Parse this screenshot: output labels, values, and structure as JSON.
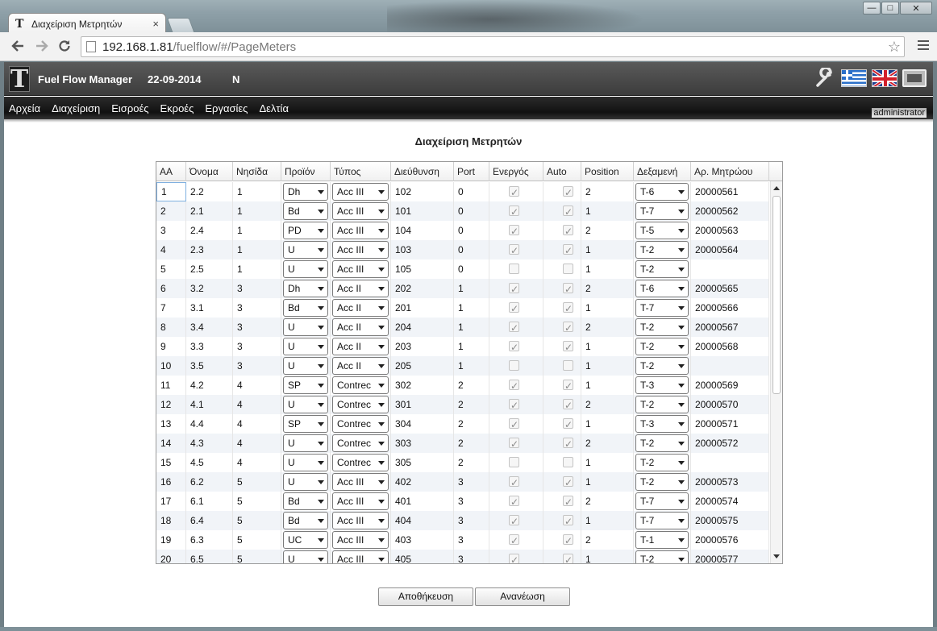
{
  "browser": {
    "tab_title": "Διαχείριση Μετρητών",
    "tab_close": "×",
    "url_host": "192.168.1.81",
    "url_path": "/fuelflow/#/PageMeters",
    "window_min": "—",
    "window_max": "□",
    "window_close": "✕"
  },
  "header": {
    "app_name": "Fuel Flow Manager",
    "date": "22-09-2014",
    "flag": "N",
    "icons": [
      "wrench-icon",
      "greek-flag-icon",
      "uk-flag-icon",
      "screen-icon"
    ]
  },
  "menu": {
    "items": [
      "Αρχεία",
      "Διαχείριση",
      "Εισροές",
      "Εκροές",
      "Εργασίες",
      "Δελτία"
    ],
    "user": "administrator"
  },
  "page": {
    "title": "Διαχείριση Μετρητών"
  },
  "grid": {
    "columns": [
      "ΑΑ",
      "Όνομα",
      "Νησίδα",
      "Προϊόν",
      "Τύπος",
      "Διεύθυνση",
      "Port",
      "Ενεργός",
      "Auto",
      "Position",
      "Δεξαμενή",
      "Αρ. Μητρώου"
    ],
    "rows": [
      {
        "aa": "1",
        "name": "2.2",
        "island": "1",
        "product": "Dh",
        "type": "Acc III",
        "address": "102",
        "port": "0",
        "active": true,
        "auto": true,
        "position": "2",
        "tank": "T-6",
        "serial": "20000561"
      },
      {
        "aa": "2",
        "name": "2.1",
        "island": "1",
        "product": "Bd",
        "type": "Acc III",
        "address": "101",
        "port": "0",
        "active": true,
        "auto": true,
        "position": "1",
        "tank": "T-7",
        "serial": "20000562"
      },
      {
        "aa": "3",
        "name": "2.4",
        "island": "1",
        "product": "PD",
        "type": "Acc III",
        "address": "104",
        "port": "0",
        "active": true,
        "auto": true,
        "position": "2",
        "tank": "T-5",
        "serial": "20000563"
      },
      {
        "aa": "4",
        "name": "2.3",
        "island": "1",
        "product": "U",
        "type": "Acc III",
        "address": "103",
        "port": "0",
        "active": true,
        "auto": true,
        "position": "1",
        "tank": "T-2",
        "serial": "20000564"
      },
      {
        "aa": "5",
        "name": "2.5",
        "island": "1",
        "product": "U",
        "type": "Acc III",
        "address": "105",
        "port": "0",
        "active": false,
        "auto": false,
        "position": "1",
        "tank": "T-2",
        "serial": ""
      },
      {
        "aa": "6",
        "name": "3.2",
        "island": "3",
        "product": "Dh",
        "type": "Acc II",
        "address": "202",
        "port": "1",
        "active": true,
        "auto": true,
        "position": "2",
        "tank": "T-6",
        "serial": "20000565"
      },
      {
        "aa": "7",
        "name": "3.1",
        "island": "3",
        "product": "Bd",
        "type": "Acc II",
        "address": "201",
        "port": "1",
        "active": true,
        "auto": true,
        "position": "1",
        "tank": "T-7",
        "serial": "20000566"
      },
      {
        "aa": "8",
        "name": "3.4",
        "island": "3",
        "product": "U",
        "type": "Acc II",
        "address": "204",
        "port": "1",
        "active": true,
        "auto": true,
        "position": "2",
        "tank": "T-2",
        "serial": "20000567"
      },
      {
        "aa": "9",
        "name": "3.3",
        "island": "3",
        "product": "U",
        "type": "Acc II",
        "address": "203",
        "port": "1",
        "active": true,
        "auto": true,
        "position": "1",
        "tank": "T-2",
        "serial": "20000568"
      },
      {
        "aa": "10",
        "name": "3.5",
        "island": "3",
        "product": "U",
        "type": "Acc II",
        "address": "205",
        "port": "1",
        "active": false,
        "auto": false,
        "position": "1",
        "tank": "T-2",
        "serial": ""
      },
      {
        "aa": "11",
        "name": "4.2",
        "island": "4",
        "product": "SP",
        "type": "Contrec",
        "address": "302",
        "port": "2",
        "active": true,
        "auto": true,
        "position": "1",
        "tank": "T-3",
        "serial": "20000569"
      },
      {
        "aa": "12",
        "name": "4.1",
        "island": "4",
        "product": "U",
        "type": "Contrec",
        "address": "301",
        "port": "2",
        "active": true,
        "auto": true,
        "position": "2",
        "tank": "T-2",
        "serial": "20000570"
      },
      {
        "aa": "13",
        "name": "4.4",
        "island": "4",
        "product": "SP",
        "type": "Contrec",
        "address": "304",
        "port": "2",
        "active": true,
        "auto": true,
        "position": "1",
        "tank": "T-3",
        "serial": "20000571"
      },
      {
        "aa": "14",
        "name": "4.3",
        "island": "4",
        "product": "U",
        "type": "Contrec",
        "address": "303",
        "port": "2",
        "active": true,
        "auto": true,
        "position": "2",
        "tank": "T-2",
        "serial": "20000572"
      },
      {
        "aa": "15",
        "name": "4.5",
        "island": "4",
        "product": "U",
        "type": "Contrec",
        "address": "305",
        "port": "2",
        "active": false,
        "auto": false,
        "position": "1",
        "tank": "T-2",
        "serial": ""
      },
      {
        "aa": "16",
        "name": "6.2",
        "island": "5",
        "product": "U",
        "type": "Acc III",
        "address": "402",
        "port": "3",
        "active": true,
        "auto": true,
        "position": "1",
        "tank": "T-2",
        "serial": "20000573"
      },
      {
        "aa": "17",
        "name": "6.1",
        "island": "5",
        "product": "Bd",
        "type": "Acc III",
        "address": "401",
        "port": "3",
        "active": true,
        "auto": true,
        "position": "2",
        "tank": "T-7",
        "serial": "20000574"
      },
      {
        "aa": "18",
        "name": "6.4",
        "island": "5",
        "product": "Bd",
        "type": "Acc III",
        "address": "404",
        "port": "3",
        "active": true,
        "auto": true,
        "position": "1",
        "tank": "T-7",
        "serial": "20000575"
      },
      {
        "aa": "19",
        "name": "6.3",
        "island": "5",
        "product": "UC",
        "type": "Acc III",
        "address": "403",
        "port": "3",
        "active": true,
        "auto": true,
        "position": "2",
        "tank": "T-1",
        "serial": "20000576"
      },
      {
        "aa": "20",
        "name": "6.5",
        "island": "5",
        "product": "U",
        "type": "Acc III",
        "address": "405",
        "port": "3",
        "active": true,
        "auto": true,
        "position": "1",
        "tank": "T-2",
        "serial": "20000577"
      }
    ]
  },
  "buttons": {
    "save": "Αποθήκευση",
    "refresh": "Ανανέωση"
  }
}
